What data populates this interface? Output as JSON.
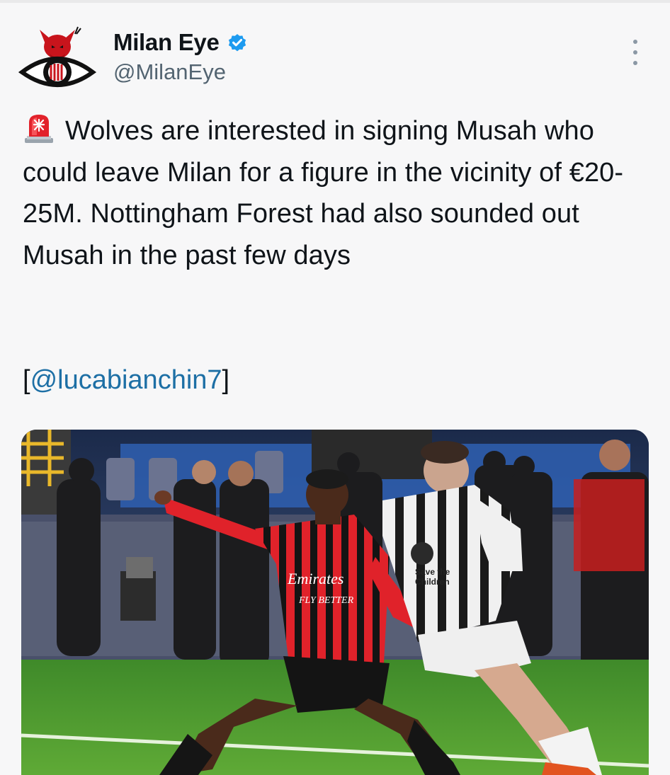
{
  "account": {
    "display_name": "Milan Eye",
    "handle": "@MilanEye",
    "verified": true,
    "avatar_icon": "devil-eye-logo-icon"
  },
  "menu": {
    "more_icon": "vertical-ellipsis-icon"
  },
  "tweet": {
    "alert_icon": "police-siren-emoji-icon",
    "text": "Wolves are interested in signing Musah who could leave Milan for a figure in the vicinity of €20-25M. Nottingham Forest had also sounded out Musah in the past few days",
    "source_open": "[",
    "source_mention": "@lucabianchin7",
    "source_close": "]"
  },
  "media": {
    "kind": "photo",
    "jersey_sponsor_1": "Emirates",
    "jersey_sponsor_2": "FLY BETTER",
    "jersey_charity_1": "Save the",
    "jersey_charity_2": "Children"
  },
  "colors": {
    "link": "#1d6fa5",
    "verified": "#1d9bf0",
    "text": "#0f1419",
    "secondary": "#536471",
    "milan_red": "#d5202b",
    "juve_white": "#f2f2f2"
  }
}
